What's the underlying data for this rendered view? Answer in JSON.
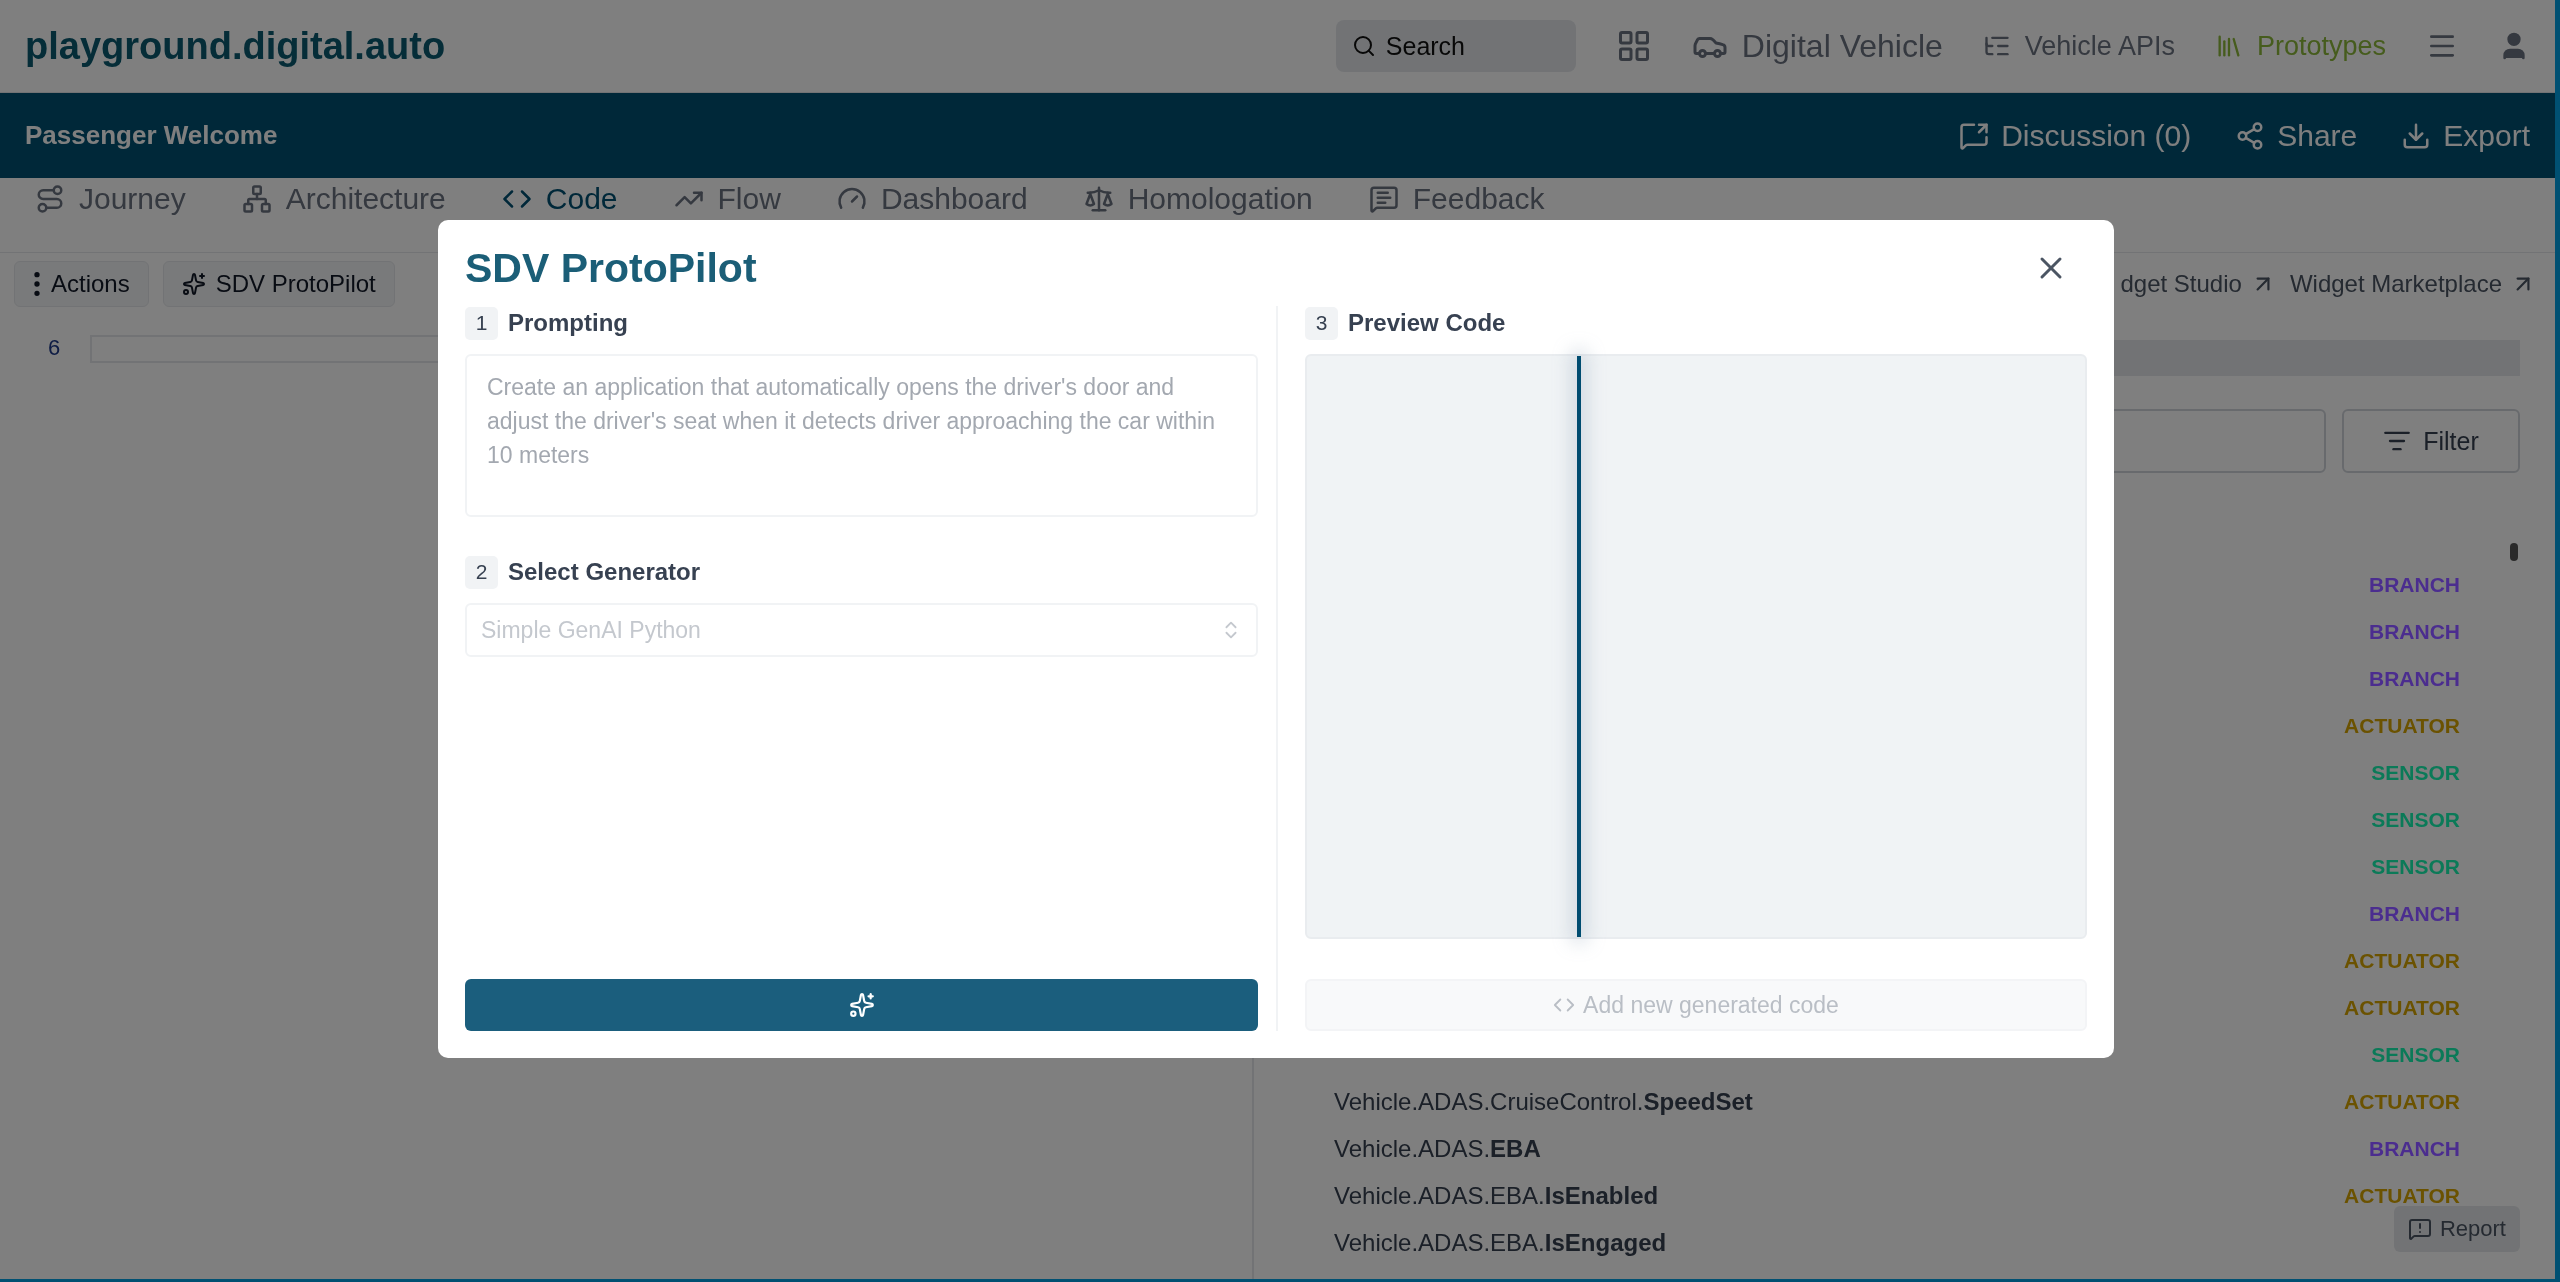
{
  "top_bar": {
    "logo": "playground.digital.auto",
    "search": {
      "placeholder": "Search"
    },
    "nav": [
      {
        "kind": "grid",
        "selected": false
      },
      {
        "kind": "car",
        "label": "Digital Vehicle",
        "selected": false
      },
      {
        "kind": "list",
        "label": "Vehicle APIs",
        "selected": false
      },
      {
        "kind": "library",
        "label": "Prototypes",
        "selected": true
      }
    ]
  },
  "prototype_bar": {
    "title": "Passenger Welcome",
    "actions": [
      {
        "kind": "discussion",
        "label": "Discussion (0)"
      },
      {
        "kind": "share",
        "label": "Share"
      },
      {
        "kind": "export",
        "label": "Export"
      }
    ]
  },
  "tabs": [
    {
      "kind": "journey",
      "label": "Journey",
      "selected": false
    },
    {
      "kind": "architecture",
      "label": "Architecture",
      "selected": false
    },
    {
      "kind": "code",
      "label": "Code",
      "selected": true
    },
    {
      "kind": "flow",
      "label": "Flow",
      "selected": false
    },
    {
      "kind": "dashboard",
      "label": "Dashboard",
      "selected": false
    },
    {
      "kind": "homologation",
      "label": "Homologation",
      "selected": false
    },
    {
      "kind": "feedback",
      "label": "Feedback",
      "selected": false
    }
  ],
  "toolbar": {
    "buttons": [
      {
        "kind": "menu",
        "label": "Actions"
      },
      {
        "kind": "sparkle",
        "label": "SDV ProtoPilot"
      }
    ],
    "links": [
      "dget Studio",
      "Widget Marketplace"
    ]
  },
  "editor": {
    "line_number": "6"
  },
  "signals": {
    "filter_button": "Filter",
    "rows": [
      {
        "type": "BRANCH",
        "color": "#4b2d8f"
      },
      {
        "type": "BRANCH",
        "color": "#4b2d8f"
      },
      {
        "type": "BRANCH",
        "color": "#4b2d8f"
      },
      {
        "type": "ACTUATOR",
        "color": "#6b5200"
      },
      {
        "type": "SENSOR",
        "color": "#0b7a58"
      },
      {
        "type": "SENSOR",
        "color": "#0b7a58"
      },
      {
        "type": "SENSOR",
        "color": "#0b7a58"
      },
      {
        "type": "BRANCH",
        "color": "#4b2d8f"
      },
      {
        "type": "ACTUATOR",
        "color": "#6b5200"
      },
      {
        "type": "ACTUATOR",
        "color": "#6b5200"
      },
      {
        "type": "SENSOR",
        "color": "#0b7a58"
      },
      {
        "name": "Vehicle.ADAS.CruiseControl.**SpeedSet**",
        "type": "ACTUATOR",
        "color": "#6b5200"
      },
      {
        "name": "Vehicle.ADAS.**EBA**",
        "type": "BRANCH",
        "color": "#4b2d8f"
      },
      {
        "name": "Vehicle.ADAS.EBA.**IsEnabled**",
        "type": "ACTUATOR",
        "color": "#6b5200"
      },
      {
        "name": "Vehicle.ADAS.EBA.**IsEngaged**"
      }
    ]
  },
  "report_button": "Report",
  "dialog": {
    "title": "SDV ProtoPilot",
    "steps": [
      {
        "number": "1",
        "label": "Prompting"
      },
      {
        "number": "2",
        "label": "Select Generator"
      },
      {
        "number": "3",
        "label": "Preview Code"
      }
    ],
    "prompt": {
      "placeholder": "Create an application that automatically opens the driver's door and adjust the driver's seat when it detects driver approaching the car within 10 meters"
    },
    "generator": {
      "value": "Simple GenAI Python",
      "disabled": true
    },
    "generate_button": {
      "disabled": false
    },
    "add_button": {
      "label": "Add new generated code",
      "disabled": true
    }
  }
}
